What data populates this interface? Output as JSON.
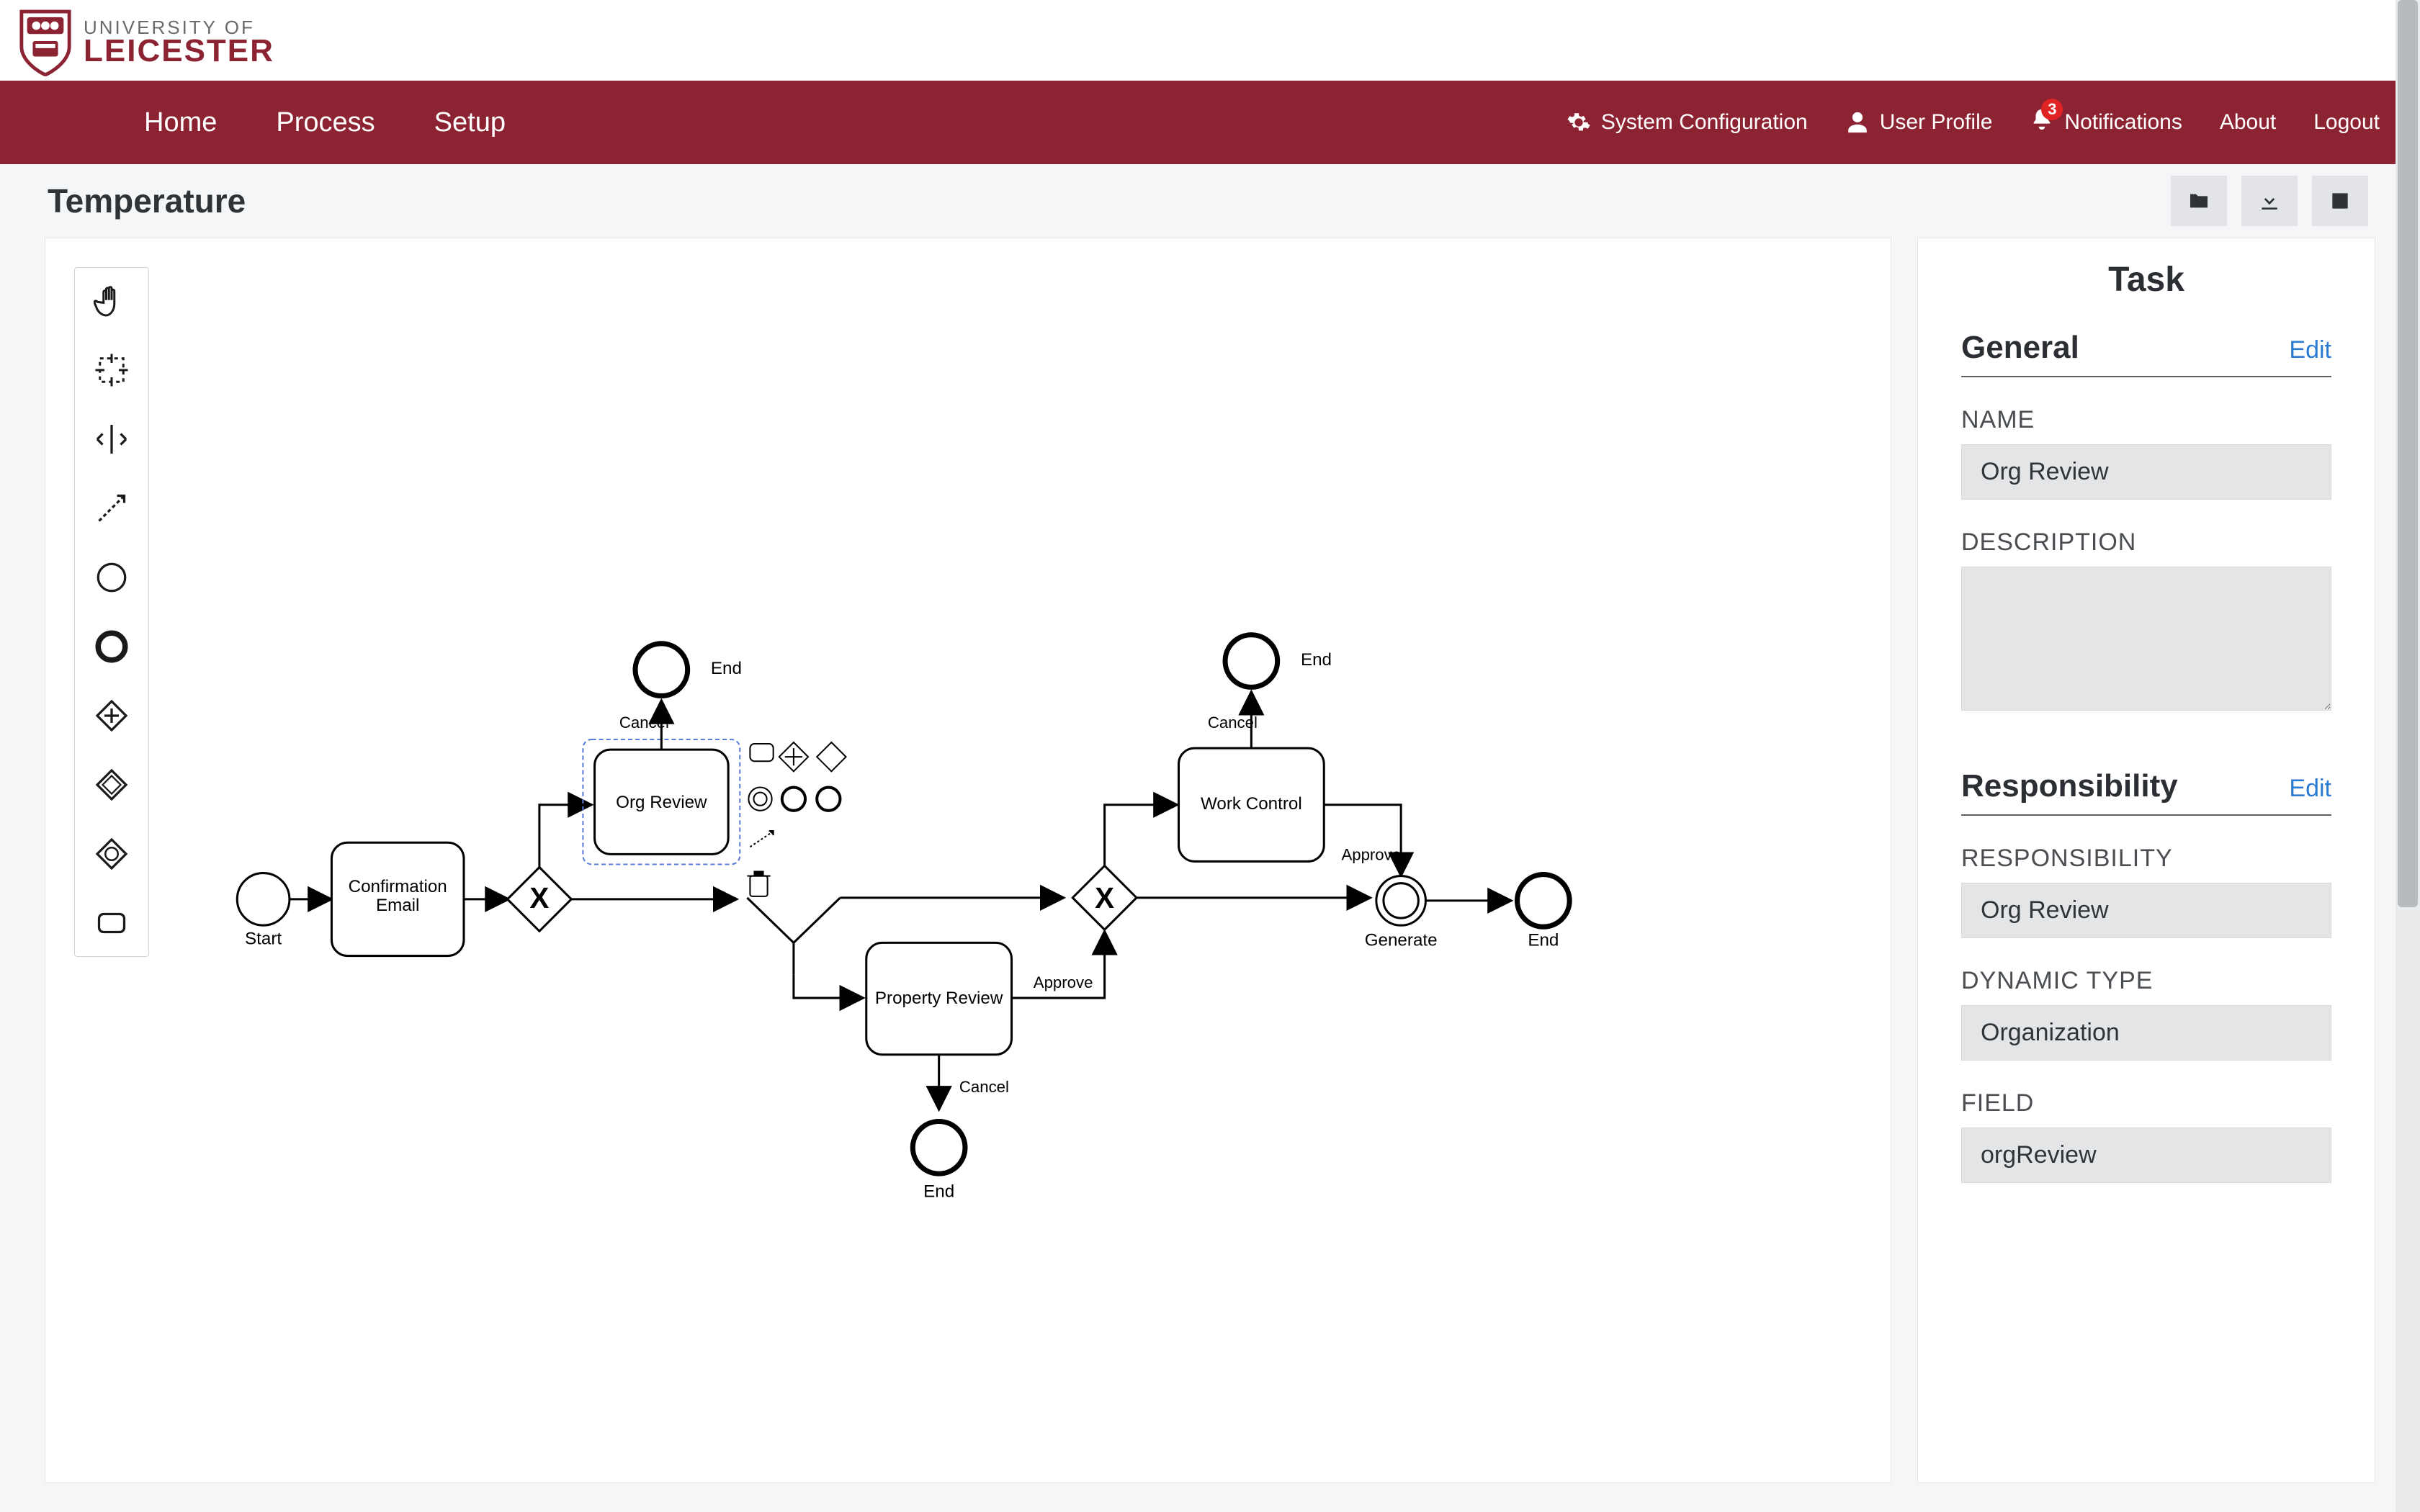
{
  "brand": {
    "line1": "UNIVERSITY OF",
    "line2": "LEICESTER"
  },
  "nav": {
    "home": "Home",
    "process": "Process",
    "setup": "Setup",
    "system_config": "System Configuration",
    "user_profile": "User Profile",
    "notifications": "Notifications",
    "notification_count": "3",
    "about": "About",
    "logout": "Logout"
  },
  "page_title": "Temperature",
  "palette_tools": {
    "hand": "hand-tool",
    "lasso": "lasso-tool",
    "space": "space-tool",
    "connect": "connect-tool",
    "start_event": "start-event",
    "end_event": "end-event",
    "intermediate_event": "intermediate-event",
    "exclusive_gateway": "exclusive-gateway",
    "event_gateway": "event-based-gateway",
    "task": "task"
  },
  "diagram": {
    "start_label": "Start",
    "task1": "Confirmation Email",
    "task2": "Org Review",
    "task3": "Property Review",
    "task4": "Work Control",
    "gateway_cancel_a": "Cancel",
    "gateway_cancel_b": "Cancel",
    "gateway_cancel_c": "Cancel",
    "end_a": "End",
    "end_b": "End",
    "end_c": "End",
    "end_d": "End",
    "approve_a": "Approve",
    "approve_b": "Approve",
    "generate": "Generate"
  },
  "inspector": {
    "title": "Task",
    "general_heading": "General",
    "edit": "Edit",
    "name_label": "NAME",
    "name_value": "Org Review",
    "description_label": "DESCRIPTION",
    "description_value": "",
    "responsibility_heading": "Responsibility",
    "responsibility_label": "RESPONSIBILITY",
    "responsibility_value": "Org Review",
    "dynamic_type_label": "DYNAMIC TYPE",
    "dynamic_type_value": "Organization",
    "field_label": "FIELD",
    "field_value": "orgReview"
  }
}
